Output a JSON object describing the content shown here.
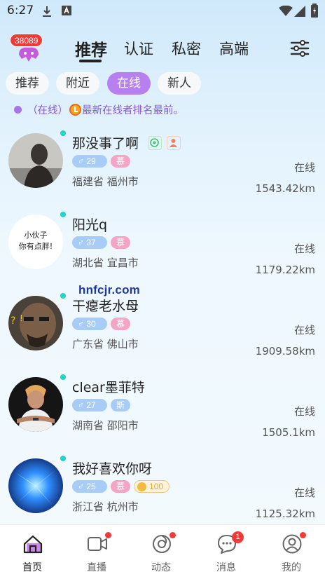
{
  "status_bar": {
    "time": "6:27"
  },
  "header": {
    "notification_count": "38089",
    "tabs": [
      {
        "label": "推荐",
        "active": true
      },
      {
        "label": "认证",
        "active": false
      },
      {
        "label": "私密",
        "active": false
      },
      {
        "label": "高端",
        "active": false
      }
    ]
  },
  "filters": [
    {
      "label": "推荐",
      "active": false
    },
    {
      "label": "附近",
      "active": false
    },
    {
      "label": "在线",
      "active": true
    },
    {
      "label": "新人",
      "active": false
    }
  ],
  "notice": {
    "prefix": "（在线）",
    "text": "最新在线者排名最前。"
  },
  "watermark": "hnfcjr.com",
  "users": [
    {
      "name": "那没事了啊",
      "age": "29",
      "tag2": "慕",
      "location": "福建省 福州市",
      "status": "在线",
      "distance": "1543.42km",
      "verified_icons": true
    },
    {
      "name": "阳光q",
      "age": "37",
      "tag2": "慕",
      "location": "湖北省 宜昌市",
      "status": "在线",
      "distance": "1179.22km",
      "avatar_text_1": "小伙子",
      "avatar_text_2": "你有点胖!"
    },
    {
      "name": "干瘪老水母",
      "age": "30",
      "tag2": "慕",
      "location": "广东省 佛山市",
      "status": "在线",
      "distance": "1909.58km"
    },
    {
      "name": "clear墨菲特",
      "age": "27",
      "tag2": "斯",
      "location": "湖南省 邵阳市",
      "status": "在线",
      "distance": "1505.1km"
    },
    {
      "name": "我好喜欢你呀",
      "age": "25",
      "tag2": "慕",
      "coins": "100",
      "location": "浙江省 杭州市",
      "status": "在线",
      "distance": "1125.32km"
    }
  ],
  "bottom_nav": [
    {
      "label": "首页",
      "active": true
    },
    {
      "label": "直播",
      "dot": true
    },
    {
      "label": "动态",
      "dot": true
    },
    {
      "label": "消息",
      "badge": "1"
    },
    {
      "label": "我的",
      "dot": true
    }
  ]
}
